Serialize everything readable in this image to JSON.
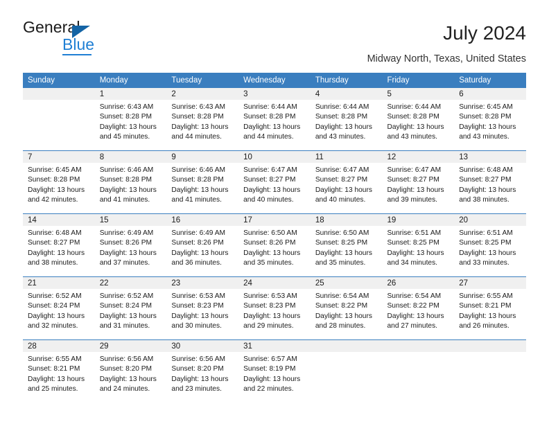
{
  "logo": {
    "word_one": "General",
    "word_two": "Blue",
    "triangle_color": "#1464a5",
    "blue_color": "#1f7fd4"
  },
  "header": {
    "title": "July 2024",
    "subtitle": "Midway North, Texas, United States"
  },
  "theme": {
    "header_bg": "#3a7ebf",
    "daynum_bg": "#f0f0f0",
    "cell_bg": "#ffffff",
    "text": "#1a1a1a"
  },
  "weekdays": [
    "Sunday",
    "Monday",
    "Tuesday",
    "Wednesday",
    "Thursday",
    "Friday",
    "Saturday"
  ],
  "weeks": [
    [
      {
        "day": "",
        "sunrise": "",
        "sunset": "",
        "daylight_1": "",
        "daylight_2": ""
      },
      {
        "day": "1",
        "sunrise": "Sunrise: 6:43 AM",
        "sunset": "Sunset: 8:28 PM",
        "daylight_1": "Daylight: 13 hours",
        "daylight_2": "and 45 minutes."
      },
      {
        "day": "2",
        "sunrise": "Sunrise: 6:43 AM",
        "sunset": "Sunset: 8:28 PM",
        "daylight_1": "Daylight: 13 hours",
        "daylight_2": "and 44 minutes."
      },
      {
        "day": "3",
        "sunrise": "Sunrise: 6:44 AM",
        "sunset": "Sunset: 8:28 PM",
        "daylight_1": "Daylight: 13 hours",
        "daylight_2": "and 44 minutes."
      },
      {
        "day": "4",
        "sunrise": "Sunrise: 6:44 AM",
        "sunset": "Sunset: 8:28 PM",
        "daylight_1": "Daylight: 13 hours",
        "daylight_2": "and 43 minutes."
      },
      {
        "day": "5",
        "sunrise": "Sunrise: 6:44 AM",
        "sunset": "Sunset: 8:28 PM",
        "daylight_1": "Daylight: 13 hours",
        "daylight_2": "and 43 minutes."
      },
      {
        "day": "6",
        "sunrise": "Sunrise: 6:45 AM",
        "sunset": "Sunset: 8:28 PM",
        "daylight_1": "Daylight: 13 hours",
        "daylight_2": "and 43 minutes."
      }
    ],
    [
      {
        "day": "7",
        "sunrise": "Sunrise: 6:45 AM",
        "sunset": "Sunset: 8:28 PM",
        "daylight_1": "Daylight: 13 hours",
        "daylight_2": "and 42 minutes."
      },
      {
        "day": "8",
        "sunrise": "Sunrise: 6:46 AM",
        "sunset": "Sunset: 8:28 PM",
        "daylight_1": "Daylight: 13 hours",
        "daylight_2": "and 41 minutes."
      },
      {
        "day": "9",
        "sunrise": "Sunrise: 6:46 AM",
        "sunset": "Sunset: 8:28 PM",
        "daylight_1": "Daylight: 13 hours",
        "daylight_2": "and 41 minutes."
      },
      {
        "day": "10",
        "sunrise": "Sunrise: 6:47 AM",
        "sunset": "Sunset: 8:27 PM",
        "daylight_1": "Daylight: 13 hours",
        "daylight_2": "and 40 minutes."
      },
      {
        "day": "11",
        "sunrise": "Sunrise: 6:47 AM",
        "sunset": "Sunset: 8:27 PM",
        "daylight_1": "Daylight: 13 hours",
        "daylight_2": "and 40 minutes."
      },
      {
        "day": "12",
        "sunrise": "Sunrise: 6:47 AM",
        "sunset": "Sunset: 8:27 PM",
        "daylight_1": "Daylight: 13 hours",
        "daylight_2": "and 39 minutes."
      },
      {
        "day": "13",
        "sunrise": "Sunrise: 6:48 AM",
        "sunset": "Sunset: 8:27 PM",
        "daylight_1": "Daylight: 13 hours",
        "daylight_2": "and 38 minutes."
      }
    ],
    [
      {
        "day": "14",
        "sunrise": "Sunrise: 6:48 AM",
        "sunset": "Sunset: 8:27 PM",
        "daylight_1": "Daylight: 13 hours",
        "daylight_2": "and 38 minutes."
      },
      {
        "day": "15",
        "sunrise": "Sunrise: 6:49 AM",
        "sunset": "Sunset: 8:26 PM",
        "daylight_1": "Daylight: 13 hours",
        "daylight_2": "and 37 minutes."
      },
      {
        "day": "16",
        "sunrise": "Sunrise: 6:49 AM",
        "sunset": "Sunset: 8:26 PM",
        "daylight_1": "Daylight: 13 hours",
        "daylight_2": "and 36 minutes."
      },
      {
        "day": "17",
        "sunrise": "Sunrise: 6:50 AM",
        "sunset": "Sunset: 8:26 PM",
        "daylight_1": "Daylight: 13 hours",
        "daylight_2": "and 35 minutes."
      },
      {
        "day": "18",
        "sunrise": "Sunrise: 6:50 AM",
        "sunset": "Sunset: 8:25 PM",
        "daylight_1": "Daylight: 13 hours",
        "daylight_2": "and 35 minutes."
      },
      {
        "day": "19",
        "sunrise": "Sunrise: 6:51 AM",
        "sunset": "Sunset: 8:25 PM",
        "daylight_1": "Daylight: 13 hours",
        "daylight_2": "and 34 minutes."
      },
      {
        "day": "20",
        "sunrise": "Sunrise: 6:51 AM",
        "sunset": "Sunset: 8:25 PM",
        "daylight_1": "Daylight: 13 hours",
        "daylight_2": "and 33 minutes."
      }
    ],
    [
      {
        "day": "21",
        "sunrise": "Sunrise: 6:52 AM",
        "sunset": "Sunset: 8:24 PM",
        "daylight_1": "Daylight: 13 hours",
        "daylight_2": "and 32 minutes."
      },
      {
        "day": "22",
        "sunrise": "Sunrise: 6:52 AM",
        "sunset": "Sunset: 8:24 PM",
        "daylight_1": "Daylight: 13 hours",
        "daylight_2": "and 31 minutes."
      },
      {
        "day": "23",
        "sunrise": "Sunrise: 6:53 AM",
        "sunset": "Sunset: 8:23 PM",
        "daylight_1": "Daylight: 13 hours",
        "daylight_2": "and 30 minutes."
      },
      {
        "day": "24",
        "sunrise": "Sunrise: 6:53 AM",
        "sunset": "Sunset: 8:23 PM",
        "daylight_1": "Daylight: 13 hours",
        "daylight_2": "and 29 minutes."
      },
      {
        "day": "25",
        "sunrise": "Sunrise: 6:54 AM",
        "sunset": "Sunset: 8:22 PM",
        "daylight_1": "Daylight: 13 hours",
        "daylight_2": "and 28 minutes."
      },
      {
        "day": "26",
        "sunrise": "Sunrise: 6:54 AM",
        "sunset": "Sunset: 8:22 PM",
        "daylight_1": "Daylight: 13 hours",
        "daylight_2": "and 27 minutes."
      },
      {
        "day": "27",
        "sunrise": "Sunrise: 6:55 AM",
        "sunset": "Sunset: 8:21 PM",
        "daylight_1": "Daylight: 13 hours",
        "daylight_2": "and 26 minutes."
      }
    ],
    [
      {
        "day": "28",
        "sunrise": "Sunrise: 6:55 AM",
        "sunset": "Sunset: 8:21 PM",
        "daylight_1": "Daylight: 13 hours",
        "daylight_2": "and 25 minutes."
      },
      {
        "day": "29",
        "sunrise": "Sunrise: 6:56 AM",
        "sunset": "Sunset: 8:20 PM",
        "daylight_1": "Daylight: 13 hours",
        "daylight_2": "and 24 minutes."
      },
      {
        "day": "30",
        "sunrise": "Sunrise: 6:56 AM",
        "sunset": "Sunset: 8:20 PM",
        "daylight_1": "Daylight: 13 hours",
        "daylight_2": "and 23 minutes."
      },
      {
        "day": "31",
        "sunrise": "Sunrise: 6:57 AM",
        "sunset": "Sunset: 8:19 PM",
        "daylight_1": "Daylight: 13 hours",
        "daylight_2": "and 22 minutes."
      },
      {
        "day": "",
        "sunrise": "",
        "sunset": "",
        "daylight_1": "",
        "daylight_2": ""
      },
      {
        "day": "",
        "sunrise": "",
        "sunset": "",
        "daylight_1": "",
        "daylight_2": ""
      },
      {
        "day": "",
        "sunrise": "",
        "sunset": "",
        "daylight_1": "",
        "daylight_2": ""
      }
    ]
  ]
}
